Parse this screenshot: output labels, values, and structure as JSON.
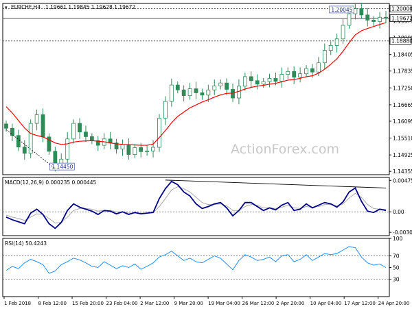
{
  "header": {
    "symbol": "EURCHF,H4",
    "ohlc": "1.19661 1.19845 1.19628 1.19672"
  },
  "watermark": "ActionForex.com",
  "colors": {
    "candle": "#2e8b57",
    "ma": "#ff0000",
    "macd": "#00008b",
    "signal": "#a9a9a9",
    "rsi": "#1e90ff",
    "axis": "#000000",
    "level": "#555555",
    "trendline": "#000000"
  },
  "chart_data": [
    {
      "id": "price",
      "type": "line",
      "title": "EURCHF,H4 1.19661 1.19845 1.19628 1.19672",
      "x_ticks": [
        "1 Feb 2018",
        "8 Feb 12:00",
        "15 Feb 20:00",
        "23 Feb 04:00",
        "2 Mar 12:00",
        "9 Mar 20:00",
        "19 Mar 04:00",
        "26 Mar 12:00",
        "2 Apr 20:00",
        "10 Apr 04:00",
        "17 Apr 12:00",
        "24 Apr 20:00"
      ],
      "y_ticks": [
        1.14355,
        1.14925,
        1.1551,
        1.16095,
        1.16665,
        1.1725,
        1.17835,
        1.18405,
        1.1899,
        1.19575
      ],
      "ylim": [
        1.1424,
        1.2018
      ],
      "series": [
        {
          "values": [
            1.1585,
            1.156,
            1.152,
            1.1498,
            1.1602,
            1.1632,
            1.1555,
            1.1505,
            1.1455,
            1.1478,
            1.1548,
            1.1602,
            1.1572,
            1.1556,
            1.1542,
            1.1526,
            1.1548,
            1.1534,
            1.1513,
            1.1528,
            1.1494,
            1.1518,
            1.1504,
            1.1506,
            1.1519,
            1.162,
            1.1678,
            1.1735,
            1.1718,
            1.1698,
            1.1722,
            1.1708,
            1.17,
            1.1718,
            1.1732,
            1.1742,
            1.172,
            1.169,
            1.1731,
            1.1764,
            1.175,
            1.1738,
            1.1747,
            1.1758,
            1.1748,
            1.1772,
            1.1782,
            1.1762,
            1.1774,
            1.1792,
            1.178,
            1.1812,
            1.1855,
            1.1872,
            1.1895,
            1.1942,
            1.1982,
            1.2,
            1.1978,
            1.196,
            1.1955,
            1.197,
            1.1967
          ]
        },
        {
          "name": "MA",
          "values": [
            1.166,
            1.1638,
            1.1612,
            1.1586,
            1.1567,
            1.156,
            1.1555,
            1.1545,
            1.1534,
            1.1529,
            1.1531,
            1.1537,
            1.154,
            1.1541,
            1.1542,
            1.154,
            1.1538,
            1.1534,
            1.1531,
            1.1529,
            1.1528,
            1.1527,
            1.1526,
            1.1526,
            1.153,
            1.1553,
            1.1577,
            1.1604,
            1.1626,
            1.1641,
            1.1656,
            1.1666,
            1.1676,
            1.1684,
            1.1693,
            1.1701,
            1.1706,
            1.1707,
            1.1713,
            1.1721,
            1.1727,
            1.1731,
            1.1734,
            1.1738,
            1.1741,
            1.1746,
            1.1752,
            1.1754,
            1.1758,
            1.1764,
            1.1767,
            1.1776,
            1.179,
            1.1807,
            1.1826,
            1.1852,
            1.1882,
            1.1909,
            1.1923,
            1.1931,
            1.1938,
            1.1945,
            1.1951
          ]
        }
      ],
      "levels": [
        {
          "value": 1.2,
          "label": "1.20000"
        },
        {
          "value": 1.1967,
          "label": "1.19672"
        },
        {
          "value": 1.1888,
          "label": "1.18880"
        }
      ],
      "annotations": [
        {
          "label": "1.20045",
          "x_index": 57,
          "value": 1.2004
        },
        {
          "label": "1.14450",
          "x_index": 8,
          "value": 1.1445
        }
      ]
    },
    {
      "id": "macd",
      "type": "line",
      "title": "MACD(12,26,9) 0.000235 0.000445",
      "y_ticks": [
        0.004754,
        0.0,
        -0.003099
      ],
      "y_tick_labels": [
        "0.004754",
        "0.00",
        "-0.003099"
      ],
      "ylim": [
        -0.0036,
        0.0052
      ],
      "series": [
        {
          "name": "MACD",
          "values": [
            -0.0008,
            -0.0012,
            -0.0015,
            -0.0018,
            -0.0002,
            0.0004,
            -0.0004,
            -0.0018,
            -0.0025,
            -0.0016,
            0.0002,
            0.0012,
            0.0007,
            0.0004,
            0.0001,
            -0.0004,
            0.0002,
            0.0001,
            -0.0003,
            0.0,
            -0.0004,
            -0.0001,
            -0.0003,
            -0.0002,
            -0.0001,
            0.002,
            0.0035,
            0.0046,
            0.0041,
            0.003,
            0.0024,
            0.0012,
            0.0005,
            0.0008,
            0.0012,
            0.0014,
            0.0006,
            -0.0006,
            0.0002,
            0.0014,
            0.0014,
            0.0008,
            0.0002,
            0.0006,
            0.0003,
            0.001,
            0.0014,
            0.0002,
            0.0004,
            0.0012,
            0.0006,
            0.001,
            0.0014,
            0.0012,
            0.0007,
            0.0015,
            0.003,
            0.0036,
            0.0016,
            0.0001,
            -0.0001,
            0.0004,
            0.0002
          ]
        },
        {
          "name": "Signal",
          "values": [
            -0.0005,
            -0.0008,
            -0.001,
            -0.0013,
            -0.0008,
            -0.0003,
            -0.0004,
            -0.001,
            -0.0017,
            -0.0016,
            -0.0008,
            0.0002,
            0.0005,
            0.0005,
            0.0004,
            0.0001,
            0.0002,
            0.0002,
            0.0,
            0.0,
            -0.0002,
            -0.0002,
            -0.0002,
            -0.0002,
            -0.0001,
            0.0008,
            0.002,
            0.0033,
            0.0038,
            0.0035,
            0.003,
            0.0022,
            0.0014,
            0.0011,
            0.0011,
            0.0012,
            0.0009,
            0.0002,
            0.0002,
            0.0008,
            0.0011,
            0.001,
            0.0006,
            0.0006,
            0.0005,
            0.0007,
            0.001,
            0.0006,
            0.0005,
            0.0008,
            0.0007,
            0.0008,
            0.0011,
            0.0011,
            0.0009,
            0.0012,
            0.0021,
            0.0028,
            0.0022,
            0.0011,
            0.0005,
            0.0004,
            0.0004
          ]
        }
      ],
      "trendline": {
        "from_index": 26,
        "from_value": 0.0048,
        "to_index": 62,
        "to_value": 0.0036
      }
    },
    {
      "id": "rsi",
      "type": "line",
      "title": "RSI(14) 50.4243",
      "y_ticks": [
        100,
        70,
        50,
        30,
        0
      ],
      "ylim": [
        0,
        100
      ],
      "reference_lines": [
        70,
        30
      ],
      "series": [
        {
          "name": "RSI",
          "values": [
            45,
            52,
            48,
            58,
            64,
            60,
            55,
            40,
            44,
            55,
            60,
            66,
            63,
            58,
            52,
            50,
            60,
            54,
            48,
            53,
            50,
            56,
            47,
            52,
            58,
            68,
            72,
            78,
            70,
            62,
            66,
            60,
            58,
            64,
            70,
            66,
            56,
            46,
            62,
            72,
            68,
            62,
            64,
            68,
            60,
            70,
            72,
            60,
            64,
            72,
            62,
            68,
            74,
            72,
            74,
            80,
            86,
            84,
            68,
            58,
            54,
            56,
            50
          ]
        }
      ]
    }
  ]
}
